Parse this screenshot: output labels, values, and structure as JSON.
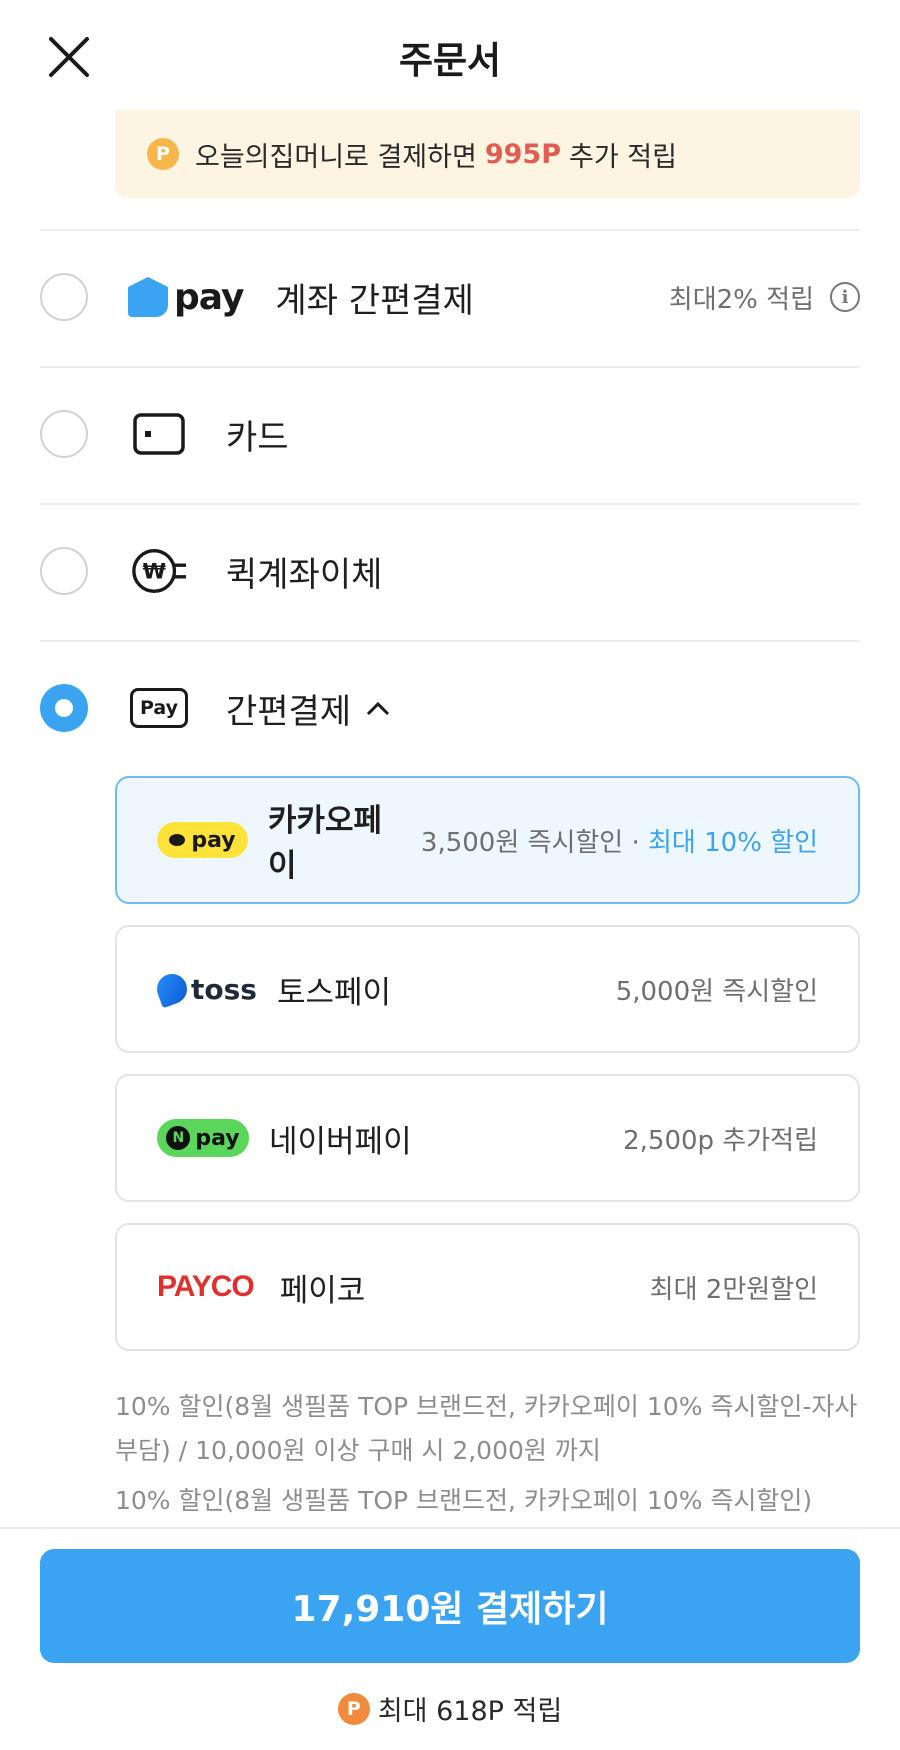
{
  "header": {
    "title": "주문서",
    "close_icon": "close-icon"
  },
  "promo": {
    "prefix": "오늘의집머니로 결제하면",
    "highlight": "995P",
    "suffix": "추가 적립",
    "coin_letter": "P"
  },
  "methods": {
    "account": {
      "logo_text": "pay",
      "label": "계좌 간편결제",
      "benefit": "최대2% 적립",
      "info_icon": "i"
    },
    "card": {
      "label": "카드"
    },
    "quick_transfer": {
      "label": "퀵계좌이체"
    },
    "easy_pay": {
      "label": "간편결제",
      "chevron": "chevron-up-icon",
      "icon_text": "Pay",
      "selected": true
    }
  },
  "easy_pay_options": [
    {
      "logo": "pay",
      "name": "카카오페이",
      "desc": "3,500원 즉시할인 ·",
      "desc_highlight": "최대 10% 할인",
      "selected": true
    },
    {
      "logo": "toss",
      "name": "토스페이",
      "desc": "5,000원 즉시할인"
    },
    {
      "logo": "pay",
      "logo_badge": "N",
      "name": "네이버페이",
      "desc": "2,500p 추가적립"
    },
    {
      "logo": "PAYCO",
      "name": "페이코",
      "desc": "최대 2만원할인"
    }
  ],
  "notes": [
    "10% 할인(8월 생필품 TOP 브랜드전, 카카오페이 10% 즉시할인-자사부담) / 10,000원 이상 구매 시 2,000원 까지",
    "10% 할인(8월 생필품 TOP 브랜드전, 카카오페이 10% 즉시할인)"
  ],
  "footer": {
    "pay_button": "17,910원 결제하기",
    "points_coin": "P",
    "points_text": "최대 618P 적립"
  },
  "colors": {
    "accent": "#3aa4f3",
    "promo_bg": "#fdf5e2",
    "highlight_red": "#e25c52",
    "kakao_yellow": "#fde23a",
    "naver_green": "#5ad75a",
    "payco_red": "#e0302d"
  }
}
